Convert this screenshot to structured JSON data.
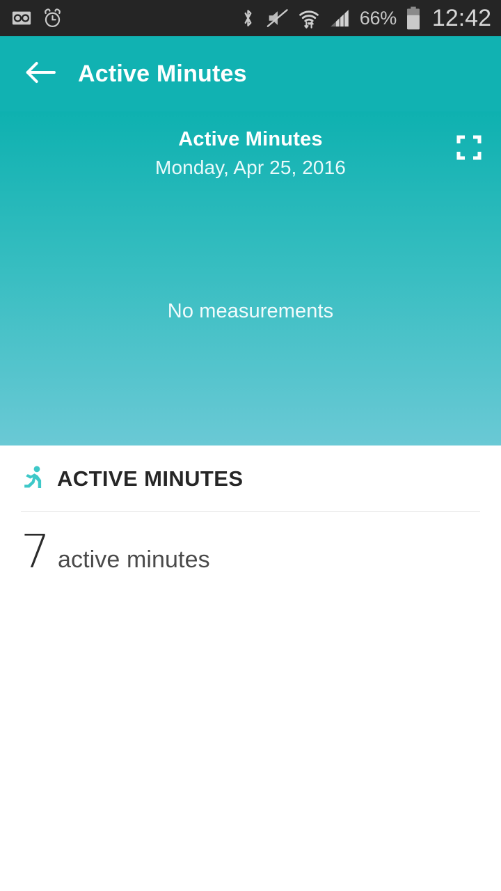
{
  "status_bar": {
    "background_color": "#252525",
    "left_icons": [
      {
        "name": "voicemail-icon",
        "label": "Voicemail"
      },
      {
        "name": "alarm-clock-icon",
        "label": "Alarm"
      }
    ],
    "right_icons": [
      {
        "name": "bluetooth-icon",
        "label": "Bluetooth"
      },
      {
        "name": "volume-mute-icon",
        "label": "Sound muted"
      },
      {
        "name": "wifi-icon",
        "label": "Wi-Fi with data transfer"
      },
      {
        "name": "cellular-signal-icon",
        "label": "Cellular signal"
      }
    ],
    "battery_percent": "66%",
    "battery_icon": "battery-icon",
    "clock": "12:42"
  },
  "app_bar": {
    "back_icon": "back-arrow-icon",
    "title": "Active Minutes",
    "background_color": "#11b2b2",
    "text_color": "#ffffff"
  },
  "graph_card": {
    "title": "Active Minutes",
    "date": "Monday, Apr 25, 2016",
    "empty_state": "No measurements",
    "expand_icon": "fullscreen-expand-icon",
    "gradient_top": "#0eb1b0",
    "gradient_bottom": "#6ac9d5"
  },
  "detail_section": {
    "icon": "running-person-icon",
    "icon_color": "#3ec8c8",
    "header": "ACTIVE MINUTES",
    "metric": {
      "value": "7",
      "unit": "active minutes"
    }
  }
}
